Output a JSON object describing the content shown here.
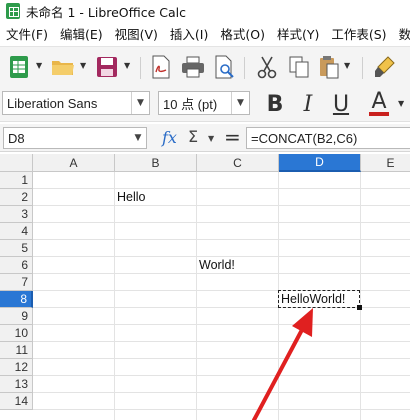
{
  "window": {
    "title": "未命名 1 - LibreOffice Calc"
  },
  "menu": [
    "文件(F)",
    "编辑(E)",
    "视图(V)",
    "插入(I)",
    "格式(O)",
    "样式(Y)",
    "工作表(S)",
    "数据(D)"
  ],
  "font_toolbar": {
    "font_name": "Liberation Sans",
    "font_size": "10 点 (pt)",
    "bold": "B",
    "italic": "I",
    "underline": "U",
    "font_color": "A"
  },
  "formula_bar": {
    "name_box": "D8",
    "fx": "fx",
    "sigma": "Σ",
    "equals": "=",
    "formula": "=CONCAT(B2,C6)"
  },
  "columns": [
    "A",
    "B",
    "C",
    "D",
    "E"
  ],
  "rows": [
    "1",
    "2",
    "3",
    "4",
    "5",
    "6",
    "7",
    "8",
    "9",
    "10",
    "11",
    "12",
    "13",
    "14"
  ],
  "cells": {
    "B2": "Hello",
    "C6": "World!",
    "D8": "HelloWorld!"
  },
  "selection": {
    "active_column": "D",
    "active_row": "8"
  },
  "colors": {
    "selection_header": "#2a77d4",
    "annotation_arrow": "#e02020",
    "calc_green": "#2e9b4b"
  }
}
